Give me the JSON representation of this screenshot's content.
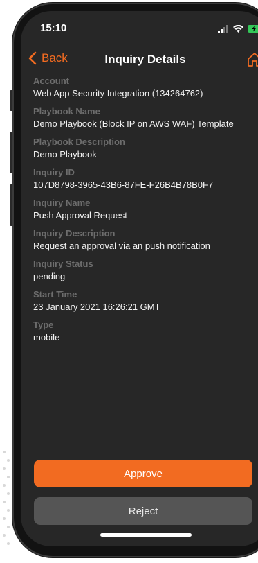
{
  "status_bar": {
    "time": "15:10"
  },
  "nav": {
    "back_label": "Back",
    "title": "Inquiry Details"
  },
  "fields": [
    {
      "label": "Account",
      "value": "Web App Security Integration (134264762)"
    },
    {
      "label": "Playbook Name",
      "value": "Demo Playbook (Block IP on AWS WAF) Template"
    },
    {
      "label": "Playbook Description",
      "value": "Demo Playbook"
    },
    {
      "label": "Inquiry ID",
      "value": "107D8798-3965-43B6-87FE-F26B4B78B0F7"
    },
    {
      "label": "Inquiry Name",
      "value": "Push Approval Request"
    },
    {
      "label": "Inquiry Description",
      "value": "Request an approval via an push notification"
    },
    {
      "label": "Inquiry Status",
      "value": "pending"
    },
    {
      "label": "Start Time",
      "value": "23 January 2021 16:26:21 GMT"
    },
    {
      "label": "Type",
      "value": "mobile"
    }
  ],
  "actions": {
    "approve_label": "Approve",
    "reject_label": "Reject"
  },
  "colors": {
    "accent": "#f26b21",
    "screen_bg": "#272727",
    "label": "#6d6d6d",
    "reject_bg": "#555555"
  },
  "icons": {
    "back": "chevron-left-icon",
    "home": "home-icon",
    "signal": "signal-icon",
    "wifi": "wifi-icon",
    "battery": "battery-charging-icon"
  }
}
